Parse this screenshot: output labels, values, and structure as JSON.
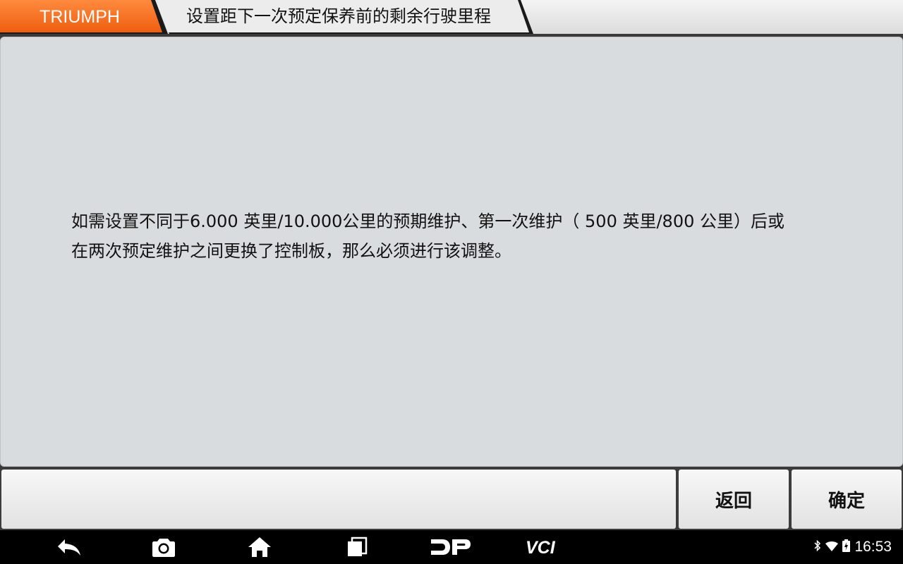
{
  "header": {
    "brand": "TRIUMPH",
    "title": "设置距下一次预定保养前的剩余行驶里程",
    "brand_color": "#f26b1d"
  },
  "content": {
    "message": "如需设置不同于6.000 英里/10.000公里的预期维护、第一次维护（ 500 英里/800 公里）后或\n在两次预定维护之间更换了控制板，那么必须进行该调整。"
  },
  "actions": {
    "back_label": "返回",
    "ok_label": "确定"
  },
  "navbar": {
    "icons": [
      "back-icon",
      "camera-icon",
      "home-icon",
      "recent-apps-icon",
      "dp-icon",
      "vci-icon"
    ],
    "status": {
      "icons": [
        "bluetooth-icon",
        "wifi-icon",
        "battery-icon"
      ],
      "time": "16:53"
    }
  }
}
